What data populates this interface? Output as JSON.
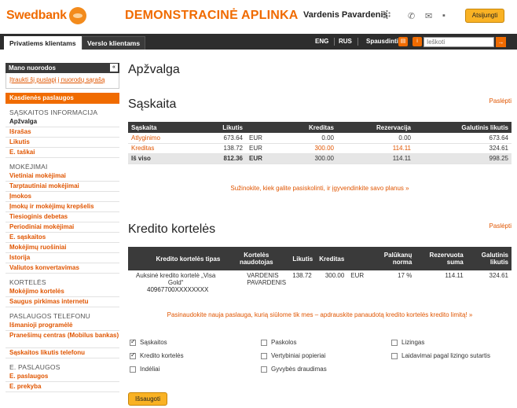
{
  "header": {
    "logo": "Swedbank",
    "demo_title": "DEMONSTRACINĖ APLINKA",
    "user_name": "Vardenis Pavardenis",
    "logout": "Atsijungti",
    "icons": [
      "gear-icon",
      "phone-icon",
      "mail-icon",
      "chat-icon"
    ]
  },
  "nav": {
    "tabs": [
      "Privatiems klientams",
      "Verslo klientams"
    ],
    "lang_eng": "ENG",
    "lang_rus": "RUS",
    "print": "Spausdinti",
    "search_placeholder": "Ieškoti"
  },
  "sidebar": {
    "my_links_title": "Mano nuorodos",
    "add_link": "Įtraukti šį puslapį į nuorodų sąrašą",
    "daily_services": "Kasdienės paslaugos",
    "groups": [
      {
        "title": "SĄSKAITOS INFORMACIJA",
        "items": [
          "Apžvalga",
          "Išrašas",
          "Likutis",
          "E. taškai"
        ]
      },
      {
        "title": "MOKĖJIMAI",
        "items": [
          "Vietiniai mokėjimai",
          "Tarptautiniai mokėjimai",
          "Įmokos",
          "Įmokų ir mokėjimų krepšelis",
          "Tiesioginis debetas",
          "Periodiniai mokėjimai",
          "E. sąskaitos",
          "Mokėjimų ruošiniai",
          "Istorija",
          "Valiutos konvertavimas"
        ]
      },
      {
        "title": "KORTELĖS",
        "items": [
          "Mokėjimo kortelės",
          "Saugus pirkimas internetu"
        ]
      },
      {
        "title": "PASLAUGOS TELEFONU",
        "items": [
          "Išmanioji programėlė",
          "Pranešimų centras (Mobilus bankas)",
          "Sąskaitos likutis telefonu"
        ]
      },
      {
        "title": "E. PASLAUGOS",
        "items": [
          "E. paslaugos",
          "E. prekyba"
        ]
      }
    ]
  },
  "main": {
    "page_title": "Apžvalga",
    "account_section": {
      "title": "Sąskaita",
      "hide": "Paslėpti",
      "columns": [
        "Sąskaita",
        "Likutis",
        "Kreditas",
        "Rezervacija",
        "Galutinis likutis"
      ],
      "rows": [
        {
          "name": "Atlyginimo",
          "balance": "673.64",
          "currency": "EUR",
          "credit": "0.00",
          "reserved": "0.00",
          "final": "673.64"
        },
        {
          "name": "Kreditas",
          "balance": "138.72",
          "currency": "EUR",
          "credit": "300.00",
          "reserved": "114.11",
          "final": "324.61"
        }
      ],
      "total": {
        "name": "Iš viso",
        "balance": "812.36",
        "currency": "EUR",
        "credit": "300.00",
        "reserved": "114.11",
        "final": "998.25"
      },
      "promo": "Sužinokite, kiek galite pasiskolinti, ir įgyvendinkite savo planus »"
    },
    "card_section": {
      "title": "Kredito kortelės",
      "hide": "Paslėpti",
      "columns": [
        "Kredito kortelės tipas",
        "Kortelės naudotojas",
        "Likutis",
        "Kreditas",
        "",
        "Palūkanų norma",
        "Rezervuota suma",
        "Galutinis likutis"
      ],
      "row": {
        "type": "Auksinė kredito kortelė „Visa Gold“",
        "number": "40967700XXXXXXXX",
        "user": "VARDENIS PAVARDENIS",
        "balance": "138.72",
        "credit": "300.00",
        "currency": "EUR",
        "rate": "17 %",
        "reserved": "114.11",
        "final": "324.61"
      },
      "promo": "Pasinaudokite nauja paslauga, kurią siūlome tik mes – apdrauskite panaudotą kredito kortelės kredito limitą! »"
    },
    "checkboxes": [
      {
        "label": "Sąskaitos",
        "checked": true
      },
      {
        "label": "Paskolos",
        "checked": false
      },
      {
        "label": "Lizingas",
        "checked": false
      },
      {
        "label": "Kredito kortelės",
        "checked": true
      },
      {
        "label": "Vertybiniai popieriai",
        "checked": false
      },
      {
        "label": "Laidavimai pagal lizingo sutartis",
        "checked": false
      },
      {
        "label": "Indėliai",
        "checked": false
      },
      {
        "label": "Gyvybės draudimas",
        "checked": false
      }
    ],
    "save": "Išsaugoti"
  }
}
